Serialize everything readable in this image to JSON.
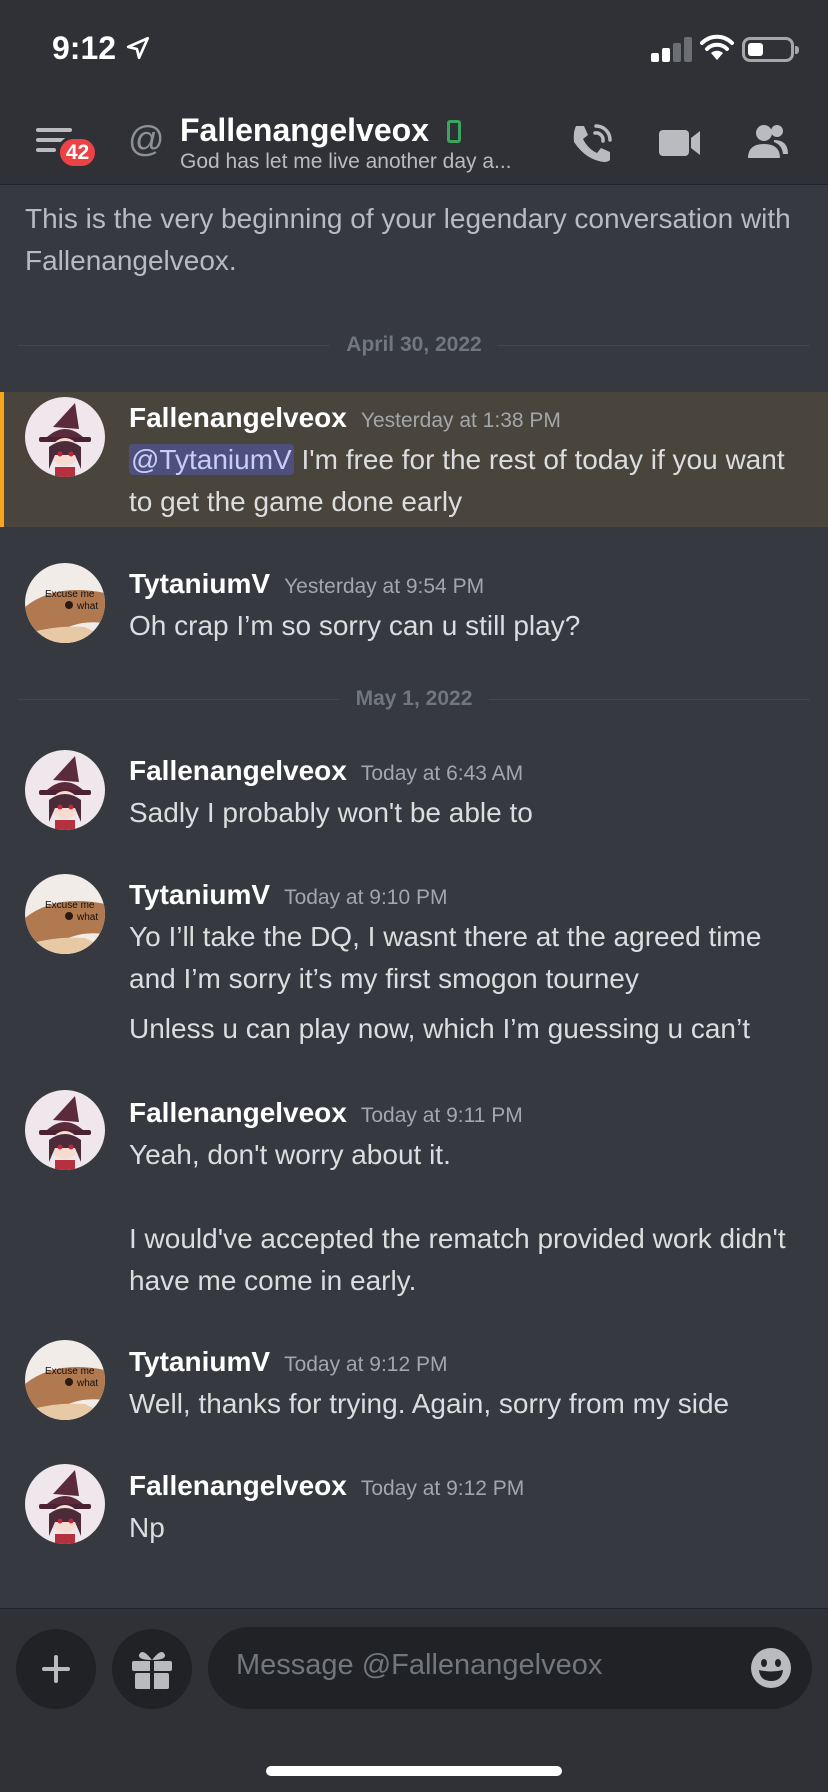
{
  "status_bar": {
    "time": "9:12"
  },
  "header": {
    "unread_badge": "42",
    "at_symbol": "@",
    "name": "Fallenangelveox",
    "status": "God has let me live another day a..."
  },
  "intro": "This is the very beginning of your legendary conversation with Fallenangelveox.",
  "dividers": [
    "April 30, 2022",
    "May 1, 2022"
  ],
  "messages": [
    {
      "author": "Fallenangelveox",
      "time": "Yesterday at 1:38 PM",
      "mention": "@TytaniumV",
      "text": " I'm free for the rest of today if you want to get the game done early"
    },
    {
      "author": "TytaniumV",
      "time": "Yesterday at 9:54 PM",
      "text": "Oh crap I’m so sorry can u still play?"
    },
    {
      "author": "Fallenangelveox",
      "time": "Today at 6:43 AM",
      "text": "Sadly I probably won't be able to"
    },
    {
      "author": "TytaniumV",
      "time": "Today at 9:10 PM",
      "text": "Yo I’ll take the DQ, I wasnt there at the agreed time and I’m sorry it’s my first smogon tourney",
      "text2": "Unless u can play now, which I’m guessing u can’t"
    },
    {
      "author": "Fallenangelveox",
      "time": "Today at 9:11 PM",
      "text": "Yeah, don't worry about it.",
      "text2": "I would've accepted the rematch provided work didn't have me come in early."
    },
    {
      "author": "TytaniumV",
      "time": "Today at 9:12 PM",
      "text": "Well, thanks for trying. Again, sorry from my side"
    },
    {
      "author": "Fallenangelveox",
      "time": "Today at 9:12 PM",
      "text": "Np"
    }
  ],
  "avatar_caption": {
    "line1": "Excuse me",
    "line2": "what"
  },
  "composer": {
    "placeholder": "Message @Fallenangelveox"
  },
  "colors": {
    "background": "#36393f",
    "header": "#2f3136",
    "highlight": "#49443c",
    "highlight_bar": "#faa61a",
    "badge": "#ed4245",
    "online": "#3ba55c"
  },
  "icons": [
    "location-arrow-icon",
    "signal-icon",
    "wifi-icon",
    "battery-icon",
    "hamburger-icon",
    "mobile-status-icon",
    "call-icon",
    "video-icon",
    "members-icon",
    "plus-icon",
    "gift-icon",
    "emoji-icon"
  ]
}
